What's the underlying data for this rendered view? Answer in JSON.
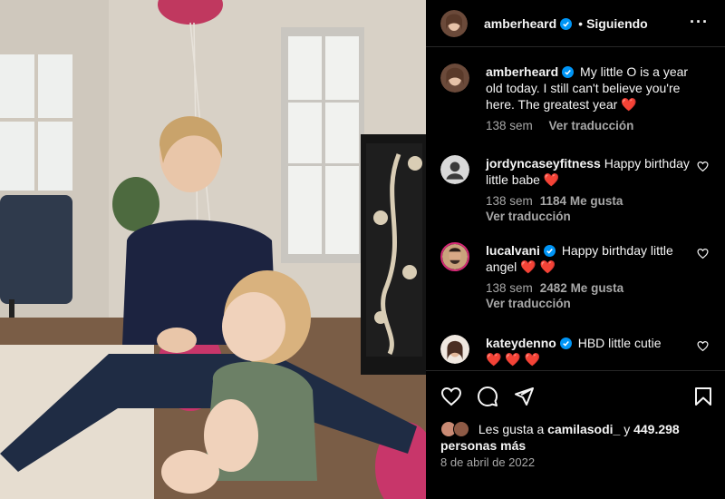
{
  "header": {
    "username": "amberheard",
    "separator": "•",
    "follow_label": "Siguiendo",
    "more_icon": "more-horizontal-icon"
  },
  "caption": {
    "username": "amberheard",
    "text": "My little O is a year old today. I still can't believe you're here. The greatest year",
    "emoji": "❤️",
    "time": "138 sem",
    "translate": "Ver traducción"
  },
  "comments": [
    {
      "username": "jordyncaseyfitness",
      "text": "Happy birthday little babe",
      "emoji": "❤️",
      "time": "138 sem",
      "likes": "1184 Me gusta",
      "translate": "Ver traducción"
    },
    {
      "username": "lucalvani",
      "text": "Happy birthday little angel",
      "emoji": "❤️ ❤️",
      "time": "138 sem",
      "likes": "2482 Me gusta",
      "translate": "Ver traducción"
    },
    {
      "username": "kateydenno",
      "text": "HBD little cutie",
      "emoji": "❤️ ❤️ ❤️"
    }
  ],
  "footer": {
    "likes_prefix": "Les gusta a",
    "likes_user": "camilasodi_",
    "likes_connector": "y",
    "likes_count": "449.298",
    "likes_suffix": "personas más",
    "date": "8 de abril de 2022"
  },
  "colors": {
    "verified": "#0095f6",
    "heart": "#ff3040",
    "secondary_text": "#a8a8a8",
    "divider": "#262626"
  }
}
